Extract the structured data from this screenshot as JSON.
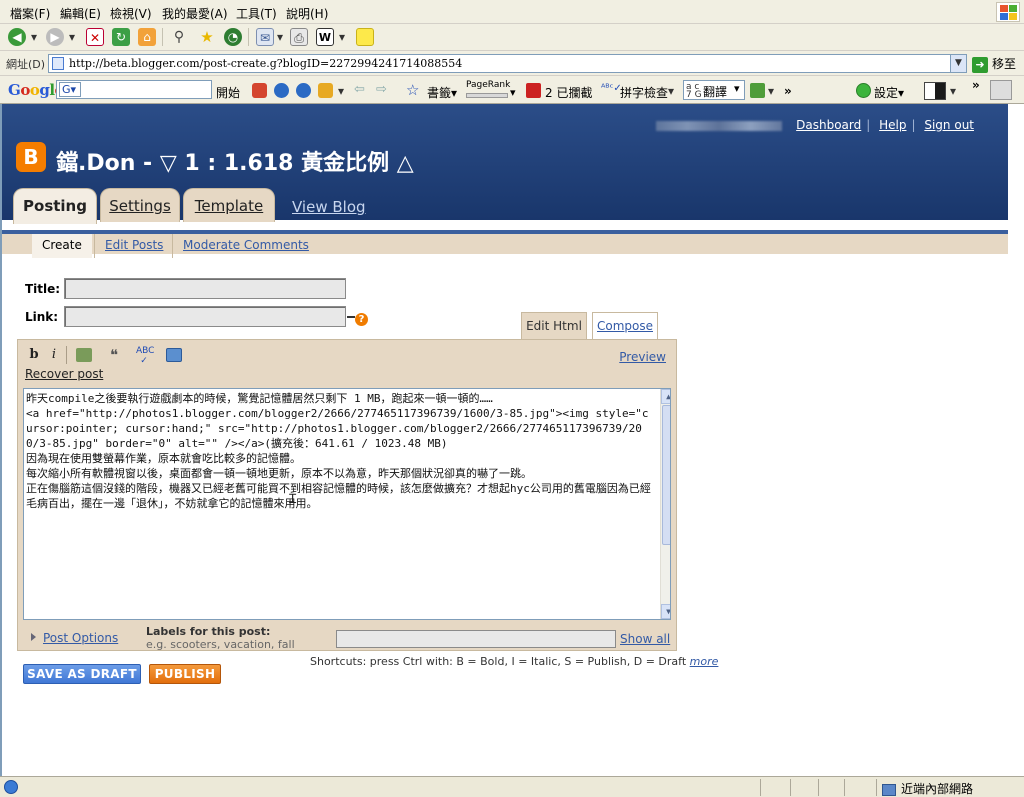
{
  "browser": {
    "menu": [
      "檔案(F)",
      "編輯(E)",
      "檢視(V)",
      "我的最愛(A)",
      "工具(T)",
      "說明(H)"
    ],
    "address_label": "網址(D)",
    "address_url": "http://beta.blogger.com/post-create.g?blogID=2272994241714088554",
    "go_label": "移至",
    "google_bar": {
      "logo": "Google",
      "search_prefix": "G▾",
      "search_label": "開始",
      "bookmarks": "書籤▾",
      "pagerank": "PageRank",
      "blocked": "2 已攔截",
      "spellcheck": "拼字檢查",
      "translate": "翻譯",
      "settings": "設定▾"
    },
    "status_zone": "近端內部網路"
  },
  "blog": {
    "top_links": [
      "Dashboard",
      "Help",
      "Sign out"
    ],
    "logo_letter": "B",
    "title": "鐺.Don - ▽ 1 : 1.618 黃金比例 △",
    "tabs": [
      "Posting",
      "Settings",
      "Template"
    ],
    "view_blog": "View Blog",
    "subtabs": [
      "Create",
      "Edit Posts",
      "Moderate Comments"
    ]
  },
  "form": {
    "title_label": "Title:",
    "link_label": "Link:",
    "help_icon": "?",
    "editor_tabs": [
      "Edit Html",
      "Compose"
    ],
    "toolbar": {
      "bold": "b",
      "italic": "i",
      "preview": "Preview"
    },
    "recover_post": "Recover post",
    "body_lines": [
      "昨天compile之後要執行遊戲劇本的時候，驚覺記憶體居然只剩下 1 MB，跑起來一頓一頓的……",
      "",
      "",
      "<a href=\"http://photos1.blogger.com/blogger2/2666/277465117396739/1600/3-85.jpg\"><img style=\"cursor:pointer; cursor:hand;\" src=\"http://photos1.blogger.com/blogger2/2666/277465117396739/200/3-85.jpg\" border=\"0\" alt=\"\" /></a>(擴充後：641.61 / 1023.48 MB)",
      "",
      "",
      "因為現在使用雙螢幕作業，原本就會吃比較多的記憶體。",
      "",
      "每次縮小所有軟體視窗以後，桌面都會一頓一頓地更新，原本不以為意，昨天那個狀況卻真的嚇了一跳。",
      "",
      "正在傷腦筋這個沒錢的階段，機器又已經老舊可能買不到相容記憶體的時候，該怎麼做擴充？才想起hyc公司用的舊電腦因為已經毛病百出，擺在一邊「退休」，不妨就拿它的記憶體來用用。"
    ],
    "post_options": "Post Options",
    "labels_title": "Labels for this post:",
    "labels_example": "e.g. scooters, vacation, fall",
    "show_all": "Show all",
    "shortcuts_text": "Shortcuts: press Ctrl with: B = Bold, I = Italic, S = Publish, D = Draft",
    "shortcuts_more": "more",
    "save_draft": "SAVE AS DRAFT",
    "publish": "PUBLISH"
  },
  "colors": {
    "header_blue": "#1e3e76",
    "tab_tan": "#e6d8c4",
    "link_blue": "#335aa6",
    "blogger_orange": "#f57d00"
  }
}
